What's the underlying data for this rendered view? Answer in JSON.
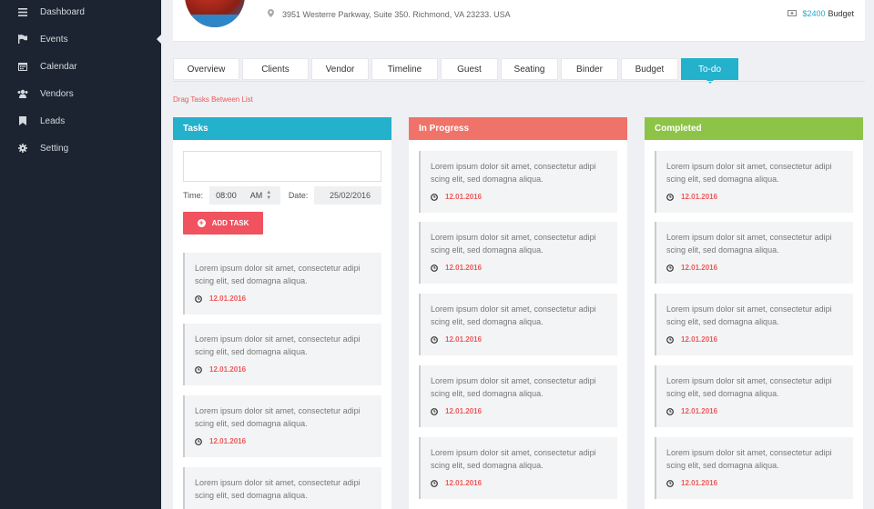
{
  "sidebar": {
    "items": [
      {
        "label": "Dashboard",
        "icon": "menu-icon"
      },
      {
        "label": "Events",
        "icon": "flag-icon"
      },
      {
        "label": "Calendar",
        "icon": "calendar-icon"
      },
      {
        "label": "Vendors",
        "icon": "users-icon"
      },
      {
        "label": "Leads",
        "icon": "bookmark-icon"
      },
      {
        "label": "Setting",
        "icon": "gear-icon"
      }
    ]
  },
  "header": {
    "address": "3951 Westerre Parkway, Suite 350. Richmond, VA 23233. USA",
    "budget_amount": "$2400",
    "budget_label": "Budget"
  },
  "tabs": [
    "Overview",
    "Clients",
    "Vendor",
    "Timeline",
    "Guest",
    "Seating",
    "Binder",
    "Budget",
    "To-do"
  ],
  "hint": "Drag Tasks Between List",
  "columns": {
    "tasks": {
      "title": "Tasks",
      "color": "#23b1cc"
    },
    "progress": {
      "title": "In Progress",
      "color": "#f0736a"
    },
    "completed": {
      "title": "Completed",
      "color": "#8dc447"
    }
  },
  "form": {
    "time_label": "Time:",
    "time_value": "08:00",
    "ampm": "AM",
    "date_label": "Date:",
    "date_value": "25/02/2016",
    "add_button": "ADD TASK"
  },
  "card": {
    "text": "Lorem ipsum dolor sit amet, consectetur adipi scing elit, sed domagna aliqua.",
    "date": "12.01.2016"
  }
}
